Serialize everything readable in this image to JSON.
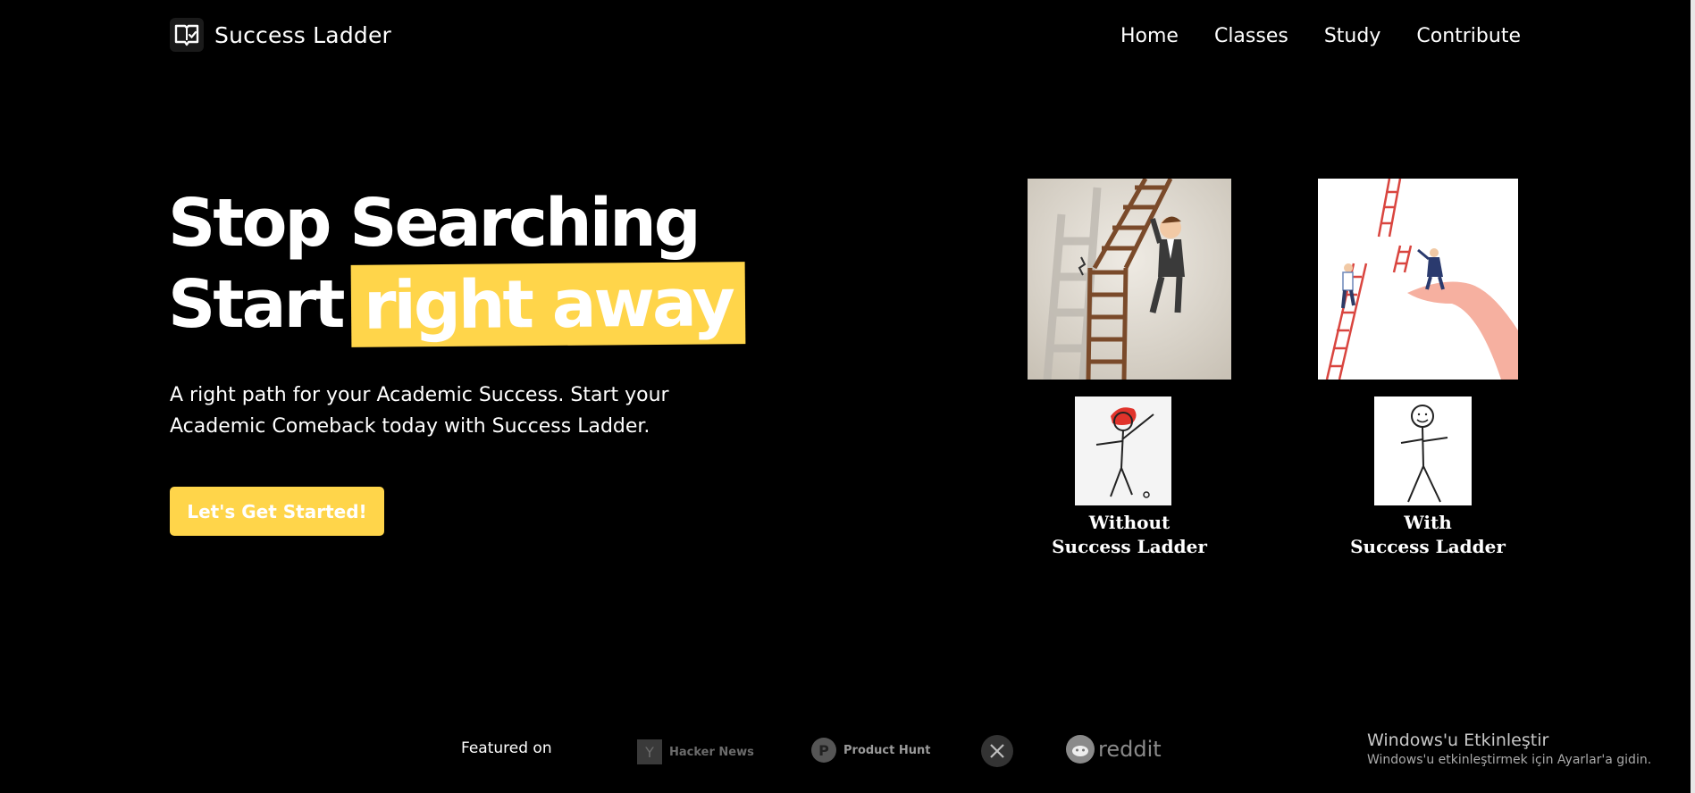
{
  "brand": {
    "name": "Success Ladder",
    "icon": "book-check-icon"
  },
  "nav": {
    "items": [
      "Home",
      "Classes",
      "Study",
      "Contribute"
    ]
  },
  "hero": {
    "title_line1": "Stop Searching",
    "title_line2_prefix": "Start",
    "title_line2_highlight": "right away",
    "subtitle": "A right path for your Academic Success. Start your Academic Comeback today with Success Ladder.",
    "cta_label": "Let's Get Started!"
  },
  "comparison": {
    "without": {
      "line1": "Without",
      "line2": "Success Ladder"
    },
    "with": {
      "line1": "With",
      "line2": "Success Ladder"
    }
  },
  "featured": {
    "label": "Featured on",
    "brands": {
      "hacker_news": "Hacker News",
      "product_hunt": "Product Hunt",
      "x": "",
      "reddit": "reddit"
    }
  },
  "windows_notice": {
    "title": "Windows'u Etkinleştir",
    "subtitle": "Windows'u etkinleştirmek için Ayarlar'a gidin."
  },
  "colors": {
    "background": "#000000",
    "accent": "#ffd54a",
    "text": "#ffffff"
  }
}
